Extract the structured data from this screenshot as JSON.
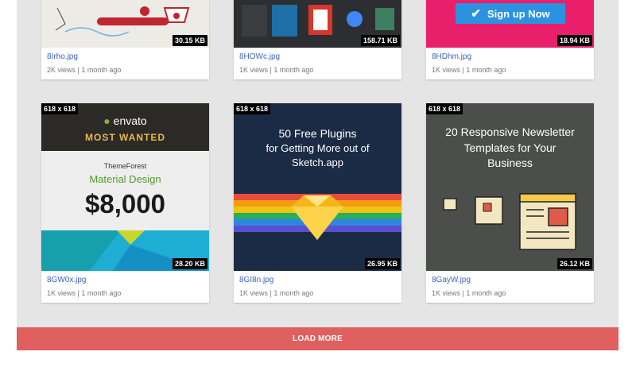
{
  "gallery": {
    "row1": [
      {
        "filename": "8Irho.jpg",
        "views": "2K views",
        "age": "1 month ago",
        "size": "30.15 KB"
      },
      {
        "filename": "8HOWc.jpg",
        "views": "1K views",
        "age": "1 month ago",
        "size": "158.71 KB"
      },
      {
        "filename": "8HDhm.jpg",
        "views": "1K views",
        "age": "1 month ago",
        "size": "18.94 KB",
        "banner_text": "Sign up Now"
      }
    ],
    "row2": [
      {
        "filename": "8GW0x.jpg",
        "views": "1K views",
        "age": "1 month ago",
        "size": "28.20 KB",
        "dims": "618 x 618",
        "brand": "envato",
        "headline": "MOST WANTED",
        "sub": "ThemeForest",
        "category": "Material Design",
        "amount": "$8,000"
      },
      {
        "filename": "8GI8n.jpg",
        "views": "1K views",
        "age": "1 month ago",
        "size": "26.95 KB",
        "dims": "618 x 618",
        "line1": "50 Free Plugins",
        "line2": "for Getting More out of",
        "line3": "Sketch.app"
      },
      {
        "filename": "8GayW.jpg",
        "views": "1K views",
        "age": "1 month ago",
        "size": "26.12 KB",
        "dims": "618 x 618",
        "line1": "20 Responsive Newsletter",
        "line2": "Templates for Your",
        "line3": "Business"
      }
    ],
    "separator": "|"
  },
  "load_more_label": "LOAD MORE",
  "colors": {
    "panel": "#e5e5e5",
    "accent": "#e06060",
    "link": "#3f63c7"
  }
}
